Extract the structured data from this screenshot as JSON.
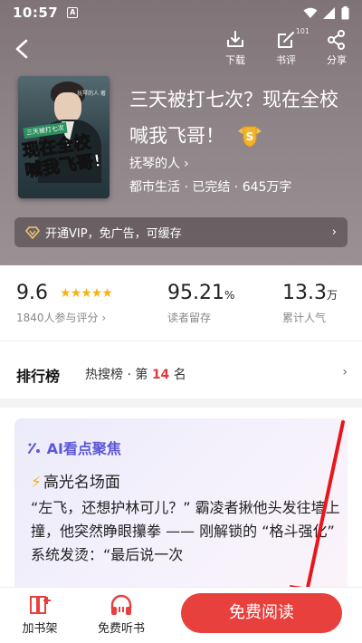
{
  "status_bar": {
    "time": "10:57",
    "app_badge": "A"
  },
  "header": {
    "actions": [
      {
        "label": "下载"
      },
      {
        "label": "书评",
        "count": "101"
      },
      {
        "label": "分享"
      }
    ]
  },
  "book": {
    "cover_title": "现在全校喊我飞哥!",
    "cover_tag": "三天被打七次",
    "cover_author": "抚琴的人 著",
    "title": "三天被打七次？现在全校喊我飞哥！",
    "vip_emblem_letter": "S",
    "author": "抚琴的人",
    "author_chevron": "›",
    "meta": "都市生活 · 已完结 · 645万字"
  },
  "vip_bar": {
    "text": "开通VIP，免广告，可缓存",
    "chevron": "›"
  },
  "stats": {
    "rating": {
      "value": "9.6",
      "stars": 5,
      "caption": "1840人参与评分 ›"
    },
    "retention": {
      "value": "95.21",
      "unit": "%",
      "caption": "读者留存"
    },
    "popularity": {
      "value": "13.3",
      "unit": "万",
      "caption": "累计人气"
    }
  },
  "ranking": {
    "title": "排行榜",
    "list_name": "热搜榜",
    "prefix": "· 第",
    "position": "14",
    "suffix": "名",
    "chevron": "›"
  },
  "ai_card": {
    "title": "AI看点聚焦",
    "subtitle": "高光名场面",
    "quote": "“左飞，还想护林可儿？” 霸凌者揪他头发往墙上撞，他突然睁眼攥拳 —— 刚解锁的 “格斗强化” 系统发烫：“最后说一次"
  },
  "bottom": {
    "add_shelf": "加书架",
    "free_listen": "免费听书",
    "read_button": "免费阅读"
  },
  "colors": {
    "accent": "#e8403d",
    "ai_purple": "#5d57d8",
    "star": "#f5b21b"
  },
  "icons": [
    "back-icon",
    "download-icon",
    "review-icon",
    "share-icon",
    "vip-diamond-icon",
    "chevron-right-icon",
    "bookshelf-add-icon",
    "headphones-icon",
    "bolt-icon"
  ]
}
